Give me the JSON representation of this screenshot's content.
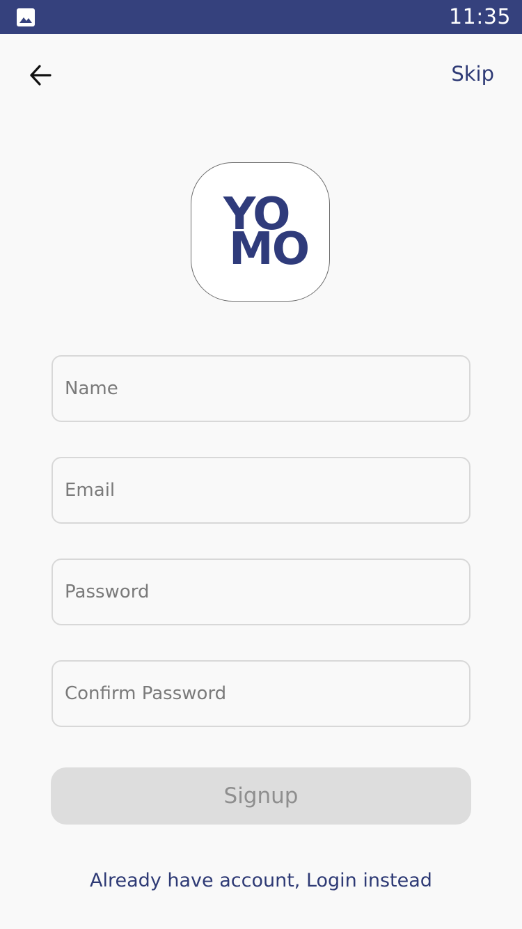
{
  "status_bar": {
    "time": "11:35",
    "left_icon": "image-icon",
    "background_color": "#35417d"
  },
  "header": {
    "back_icon": "arrow-left-icon",
    "skip_label": "Skip"
  },
  "logo": {
    "line1": "YO",
    "line2": "MO",
    "color": "#2f3b7b"
  },
  "form": {
    "name_placeholder": "Name",
    "email_placeholder": "Email",
    "password_placeholder": "Password",
    "confirm_password_placeholder": "Confirm Password",
    "name_value": "",
    "email_value": "",
    "password_value": "",
    "confirm_password_value": ""
  },
  "actions": {
    "signup_label": "Signup",
    "signup_enabled": false,
    "login_link": "Already have account, Login instead"
  },
  "colors": {
    "accent": "#2e3a75",
    "disabled_button": "#dddddd",
    "disabled_text": "#8e8e8e",
    "background": "#f9f9f9"
  }
}
